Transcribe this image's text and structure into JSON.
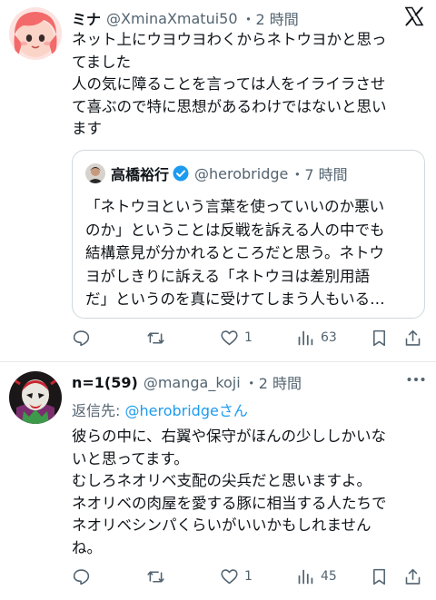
{
  "tweet1": {
    "name": "ミナ",
    "handle": "@XminaXmatui50",
    "time": "・2 時間",
    "lines": [
      "ネット上にウヨウヨわくからネトウヨかと思っ",
      "てました",
      "人の気に障ることを言っては人をイライラさせ",
      "て喜ぶので特に思想があるわけではないと思い",
      "ます"
    ],
    "quote": {
      "name": "高橋裕行",
      "handle": "@herobridge",
      "time": "・7 時間",
      "lines": [
        "「ネトウヨという言葉を使っていいのか悪い",
        "のか」ということは反戦を訴える人の中でも",
        "結構意見が分かれるところだと思う。ネトウ",
        "ヨがしきりに訴える「ネトウヨは差別用語",
        "だ」というのを真に受けてしまう人もいる…"
      ]
    },
    "actions": {
      "replies": "",
      "retweets": "",
      "likes": "1",
      "views": "63"
    },
    "logo_icon": "x-logo-icon"
  },
  "tweet2": {
    "name": "n=1(59)",
    "handle": "@manga_koji",
    "time": "・2 時間",
    "reply_prefix": "返信先: ",
    "reply_mention": "@herobridge",
    "reply_suffix": "さん",
    "lines": [
      "彼らの中に、右翼や保守がほんの少ししかいな",
      "いと思ってます。",
      "むしろネオリベ支配の尖兵だと思いますよ。",
      "ネオリベの肉屋を愛する豚に相当する人たちで",
      "ネオリベシンパくらいがいいかもしれません",
      "ね。"
    ],
    "actions": {
      "replies": "",
      "retweets": "",
      "likes": "1",
      "views": "45"
    }
  },
  "colors": {
    "text": "#0f1419",
    "secondary": "#536471",
    "accent": "#1d9bf0",
    "border": "#cfd9de"
  }
}
